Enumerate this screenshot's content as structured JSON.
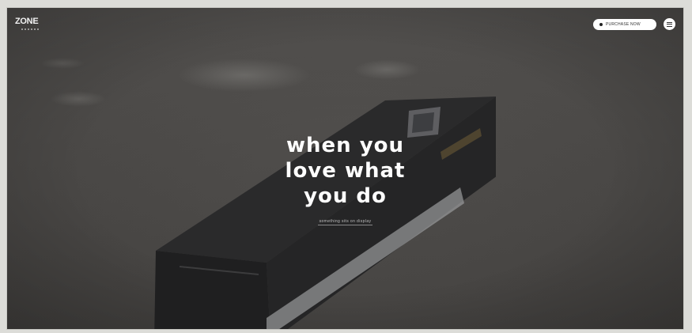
{
  "brand": {
    "logo_text": "ZONE"
  },
  "header": {
    "cta_label": "PURCHASE NOW",
    "menu_icon": "hamburger-icon"
  },
  "hero": {
    "headline_lines": [
      "when you",
      "love what",
      "you do"
    ],
    "tagline": "something sits on display"
  },
  "colors": {
    "background": "#4d4b49",
    "headline": "#ffffff",
    "pill_bg": "#ffffff"
  }
}
